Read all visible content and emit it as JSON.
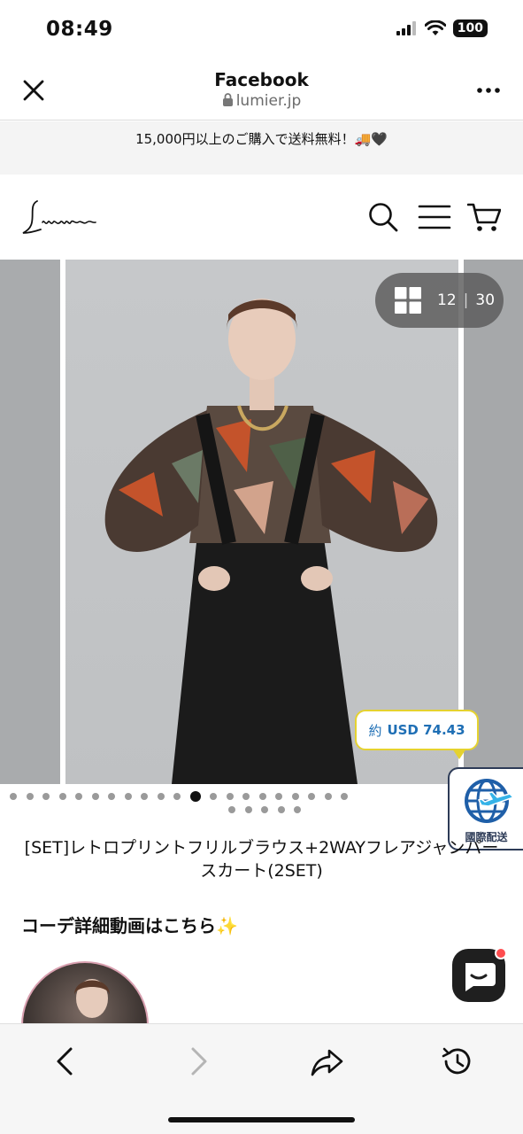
{
  "status_bar": {
    "time": "08:49",
    "battery": "100"
  },
  "browser": {
    "title": "Facebook",
    "url": "lumier.jp"
  },
  "promo": {
    "text": "15,000円以上のご購入で送料無料！🚚🖤"
  },
  "site": {
    "logo": "Lumier"
  },
  "gallery": {
    "current": "12",
    "separator": "|",
    "total": "30",
    "dots_count": 26,
    "active_dot": 11
  },
  "price": {
    "prefix": "約",
    "amount": "USD 74.43"
  },
  "intl_badge": {
    "label": "國際配送"
  },
  "product": {
    "title": "[SET]レトロプリントフリルブラウス+2WAYフレアジャンパースカート(2SET)"
  },
  "section": {
    "heading": "コーデ詳細動画はこちら✨"
  },
  "colors": {
    "accent_blue": "#1f6fb5",
    "bubble_border": "#e5d22f",
    "badge_navy": "#2d3b57",
    "chat_bg": "#1f1f1f"
  },
  "icons": [
    "close-icon",
    "more-icon",
    "lock-icon",
    "search-icon",
    "menu-icon",
    "cart-icon",
    "grid-icon",
    "globe-plane-icon",
    "chat-icon",
    "back-icon",
    "forward-icon",
    "share-icon",
    "history-icon"
  ]
}
